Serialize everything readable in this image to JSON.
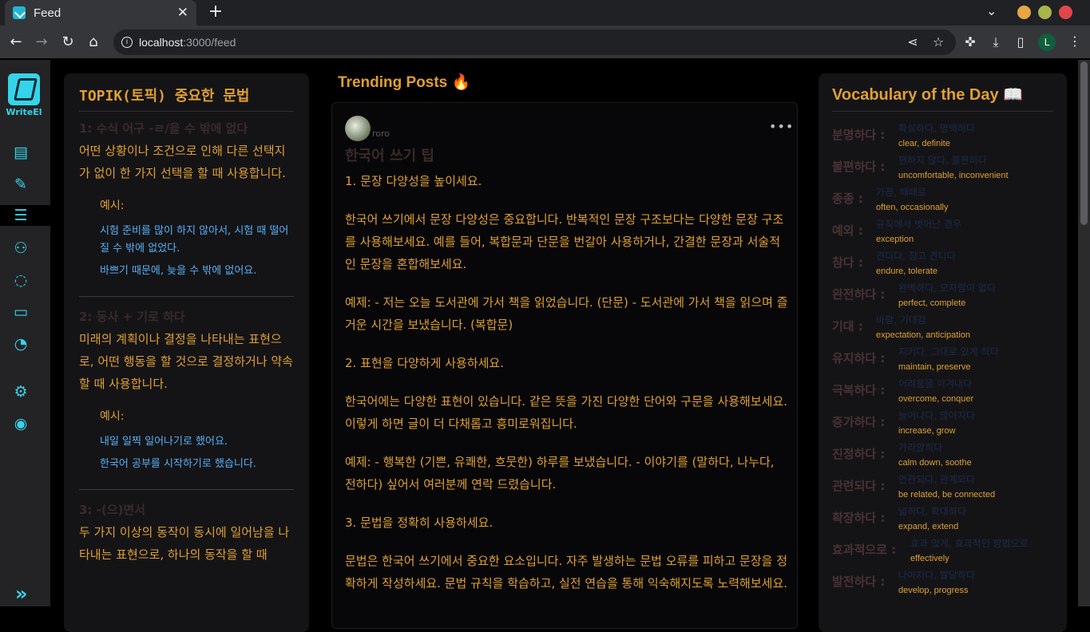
{
  "browser": {
    "tab_title": "Feed",
    "url_host": "localhost",
    "url_path": ":3000/feed",
    "profile_initial": "L"
  },
  "sidebar": {
    "logo_text": "WriteEl",
    "items": [
      "dashboard-icon",
      "new-post-icon",
      "feed-icon",
      "friends-icon",
      "chat-icon",
      "documents-icon",
      "speed-icon",
      "settings-icon",
      "profile-icon"
    ]
  },
  "grammar": {
    "title": "TOPIK(토픽) 중요한 문법",
    "items": [
      {
        "title": "1: 수식 어구 -ㄹ/을 수 밖에 없다",
        "desc": "어떤 상황이나 조건으로 인해 다른 선택지가 없이 한 가지 선택을 할 때 사용합니다.",
        "example_label": "예시:",
        "examples": [
          "시험 준비를 많이 하지 않아서, 시험 때 떨어질 수 밖에 없었다.",
          "바쁘기 때문에, 늦을 수 밖에 없어요."
        ]
      },
      {
        "title": "2: 동사 + 기로 하다",
        "desc": "미래의 계획이나 결정을 나타내는 표현으로, 어떤 행동을 할 것으로 결정하거나 약속할 때 사용합니다.",
        "example_label": "예시:",
        "examples": [
          "내일 일찍 일어나기로 했어요.",
          "한국어 공부를 시작하기로 했습니다."
        ]
      },
      {
        "title": "3: -(으)면서",
        "desc": "두 가지 이상의 동작이 동시에 일어남을 나타내는 표현으로, 하나의 동작을 할 때",
        "example_label": "",
        "examples": []
      }
    ]
  },
  "feed": {
    "heading": "Trending Posts 🔥",
    "post": {
      "username": "roro",
      "title": "한국어 쓰기 팁",
      "paragraphs": [
        "1. 문장 다양성을 높이세요.",
        "한국어 쓰기에서 문장 다양성은 중요합니다. 반복적인 문장 구조보다는 다양한 문장 구조를 사용해보세요. 예를 들어, 복합문과 단문을 번갈아 사용하거나, 간결한 문장과 서술적인 문장을 혼합해보세요.",
        "예제: - 저는 오늘 도서관에 가서 책을 읽었습니다. (단문) - 도서관에 가서 책을 읽으며 즐거운 시간을 보냈습니다. (복합문)",
        "2. 표현을 다양하게 사용하세요.",
        "한국어에는 다양한 표현이 있습니다. 같은 뜻을 가진 다양한 단어와 구문을 사용해보세요. 이렇게 하면 글이 더 다채롭고 흥미로워집니다.",
        "예제: - 행복한 (기쁜, 유쾌한, 흐뭇한) 하루를 보냈습니다. - 이야기를 (말하다, 나누다, 전하다) 싶어서 여러분께 연락 드렸습니다.",
        "3. 문법을 정확히 사용하세요.",
        "문법은 한국어 쓰기에서 중요한 요소입니다. 자주 발생하는 문법 오류를 피하고 문장을 정확하게 작성하세요. 문법 규칙을 학습하고, 실전 연습을 통해 익숙해지도록 노력해보세요."
      ]
    }
  },
  "vocab": {
    "title": "Vocabulary of the Day",
    "items": [
      {
        "word": "분명하다 :",
        "kor": "확실하다, 명백하다",
        "eng": "clear, definite"
      },
      {
        "word": "불편하다 :",
        "kor": "편하지 않다, 불편하다",
        "eng": "uncomfortable, inconvenient"
      },
      {
        "word": "종종 :",
        "kor": "가끔, 때때로",
        "eng": "often, occasionally"
      },
      {
        "word": "예외 :",
        "kor": "규칙에서 벗어난 경우",
        "eng": "exception"
      },
      {
        "word": "참다 :",
        "kor": "견디다, 참고 견디다",
        "eng": "endure, tolerate"
      },
      {
        "word": "완전하다 :",
        "kor": "완벽하다, 모자람이 없다",
        "eng": "perfect, complete"
      },
      {
        "word": "기대 :",
        "kor": "바람, 기대감",
        "eng": "expectation, anticipation"
      },
      {
        "word": "유지하다 :",
        "kor": "지키다, 그대로 있게 하다",
        "eng": "maintain, preserve"
      },
      {
        "word": "극복하다 :",
        "kor": "어려움을 이겨내다",
        "eng": "overcome, conquer"
      },
      {
        "word": "증가하다 :",
        "kor": "늘어나다, 많아지다",
        "eng": "increase, grow"
      },
      {
        "word": "진정하다 :",
        "kor": "가라앉히다",
        "eng": "calm down, soothe"
      },
      {
        "word": "관련되다 :",
        "kor": "연관되다, 관계되다",
        "eng": "be related, be connected"
      },
      {
        "word": "확장하다 :",
        "kor": "넓히다, 확대하다",
        "eng": "expand, extend"
      },
      {
        "word": "효과적으로 :",
        "kor": "효과 있게, 효과적인 방법으로",
        "eng": "effectively"
      },
      {
        "word": "발전하다 :",
        "kor": "나아지다, 발달하다",
        "eng": "develop, progress"
      }
    ]
  }
}
